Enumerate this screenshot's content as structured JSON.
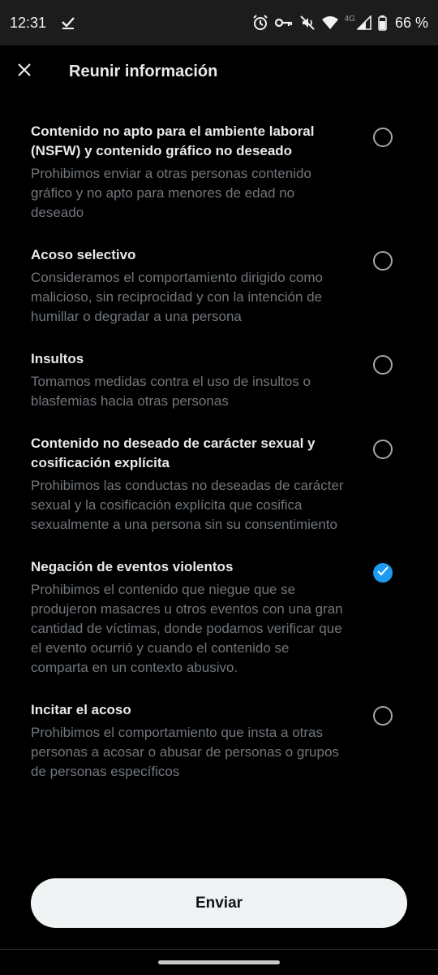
{
  "status_bar": {
    "time": "12:31",
    "battery": "66 %",
    "network": "4G"
  },
  "header": {
    "title": "Reunir información"
  },
  "options": [
    {
      "title": "Contenido no apto para el ambiente laboral (NSFW) y contenido gráfico no deseado",
      "description": "Prohibimos enviar a otras personas contenido gráfico y no apto para menores de edad no deseado",
      "checked": false
    },
    {
      "title": "Acoso selectivo",
      "description": "Consideramos el comportamiento dirigido como malicioso, sin reciprocidad y con la intención de humillar o degradar a una persona",
      "checked": false
    },
    {
      "title": "Insultos",
      "description": "Tomamos medidas contra el uso de insultos o blasfemias hacia otras personas",
      "checked": false
    },
    {
      "title": "Contenido no deseado de carácter sexual y cosificación explícita",
      "description": "Prohibimos las conductas no deseadas de carácter sexual y la cosificación explícita que cosifica sexualmente a una persona sin su consentimiento",
      "checked": false
    },
    {
      "title": "Negación de eventos violentos",
      "description": "Prohibimos el contenido que niegue que se produjeron masacres u otros eventos con una gran cantidad de víctimas, donde podamos verificar que el evento ocurrió y cuando el contenido se comparta en un contexto abusivo.",
      "checked": true
    },
    {
      "title": "Incitar el acoso",
      "description": "Prohibimos el comportamiento que insta a otras personas a acosar o abusar de personas o grupos de personas específicos",
      "checked": false
    }
  ],
  "footer": {
    "send_label": "Enviar"
  },
  "colors": {
    "accent": "#1d9bf0",
    "background": "#000000",
    "text_primary": "#e7e9ea",
    "text_secondary": "#71767b"
  }
}
